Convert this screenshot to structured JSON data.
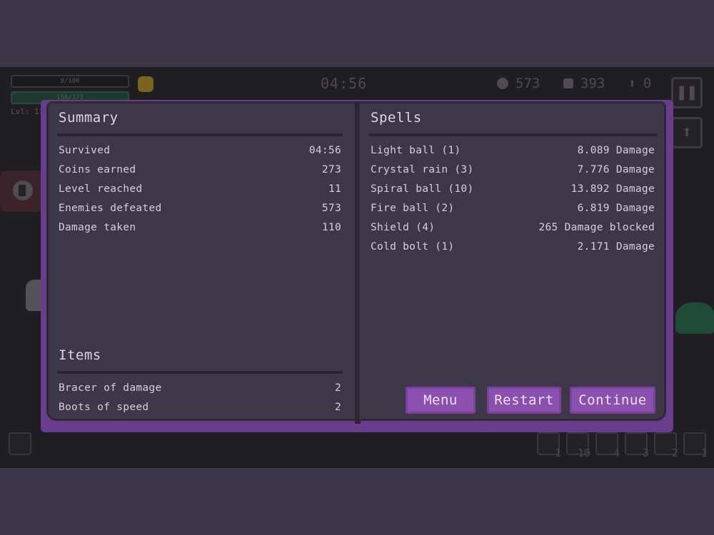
{
  "hud": {
    "hp_text": "0/100",
    "xp_text": "158/173",
    "level_text": "Lvl: 11",
    "timer": "04:56",
    "skulls": "573",
    "gems": "393",
    "upgrades": "0",
    "slots": [
      "1",
      "10",
      "4",
      "3",
      "2",
      "1"
    ]
  },
  "summary": {
    "title": "Summary",
    "rows": [
      {
        "label": "Survived",
        "value": "04:56"
      },
      {
        "label": "Coins earned",
        "value": "273"
      },
      {
        "label": "Level reached",
        "value": "11"
      },
      {
        "label": "Enemies defeated",
        "value": "573"
      },
      {
        "label": "Damage taken",
        "value": "110"
      }
    ]
  },
  "items": {
    "title": "Items",
    "rows": [
      {
        "label": "Bracer of damage",
        "value": "2"
      },
      {
        "label": "Boots of speed",
        "value": "2"
      }
    ]
  },
  "spells": {
    "title": "Spells",
    "rows": [
      {
        "label": "Light ball (1)",
        "value": "8.089 Damage"
      },
      {
        "label": "Crystal rain (3)",
        "value": "7.776 Damage"
      },
      {
        "label": "Spiral ball (10)",
        "value": "13.892 Damage"
      },
      {
        "label": "Fire ball (2)",
        "value": "6.819 Damage"
      },
      {
        "label": "Shield (4)",
        "value": "265 Damage blocked"
      },
      {
        "label": "Cold bolt (1)",
        "value": "2.171 Damage"
      }
    ]
  },
  "buttons": {
    "menu": "Menu",
    "restart": "Restart",
    "continue": "Continue"
  },
  "colors": {
    "dialog_border": "#6a3d8c",
    "page": "#3e3748",
    "button": "#8a4faf",
    "background": "#3d3548"
  }
}
